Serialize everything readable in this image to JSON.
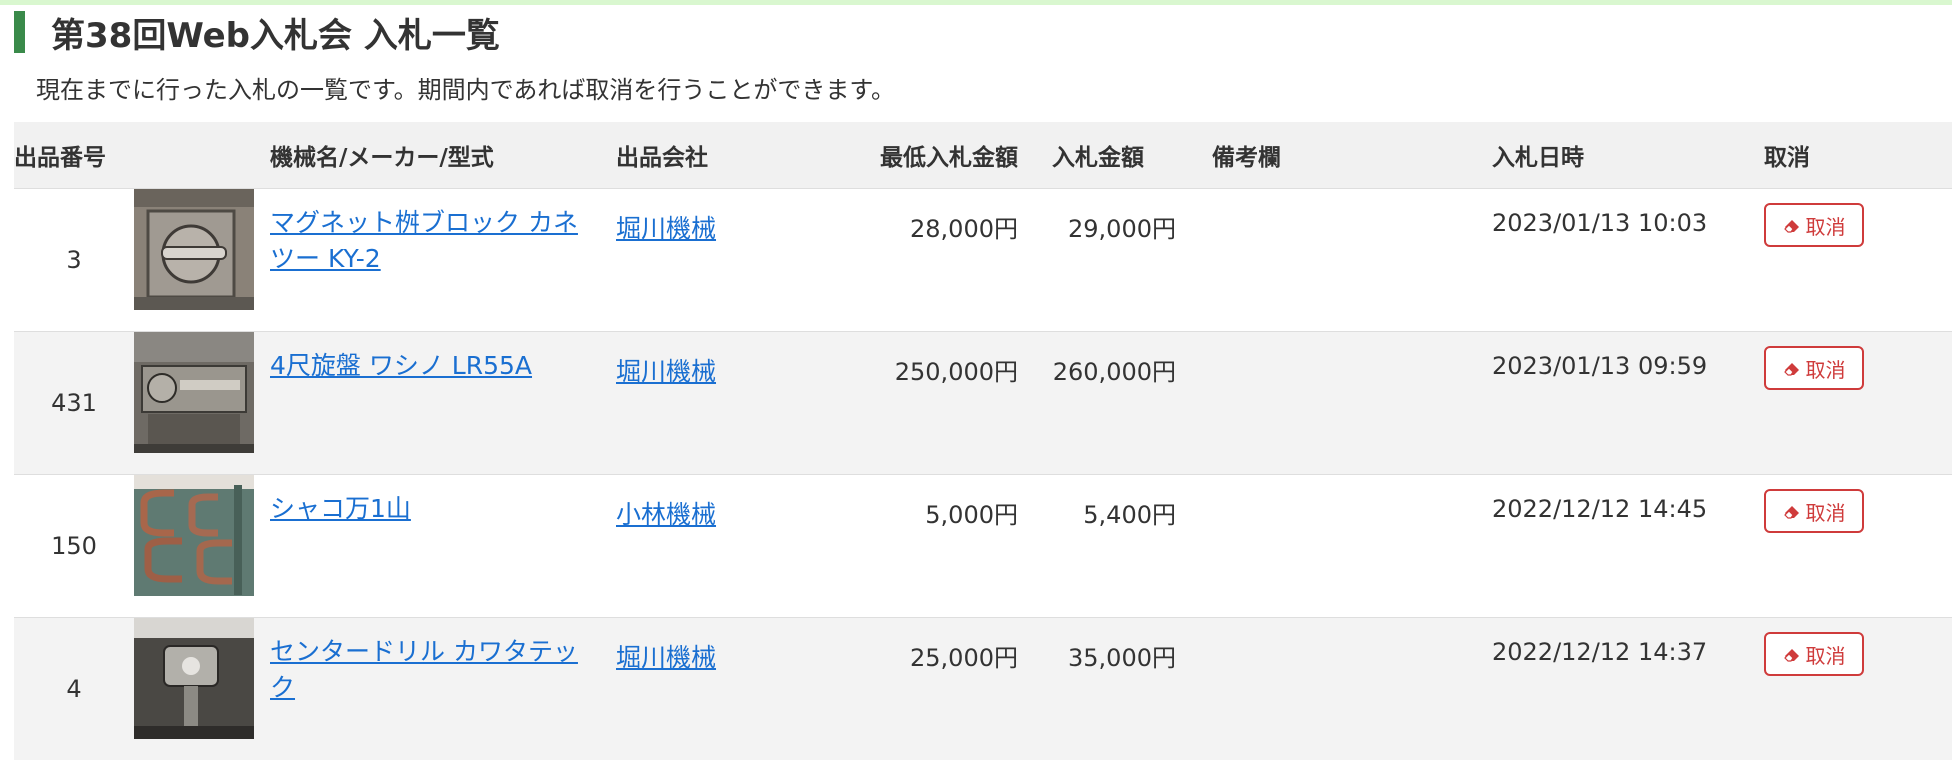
{
  "page": {
    "title": "第38回Web入札会 入札一覧",
    "description": "現在までに行った入札の一覧です。期間内であれば取消を行うことができます。",
    "accent_color": "#3a8a4a",
    "link_color": "#1a6fd1",
    "cancel_color": "#cf3b3b"
  },
  "table": {
    "headers": {
      "no": "出品番号",
      "name": "機械名/メーカー/型式",
      "company": "出品会社",
      "min_price": "最低入札金額",
      "bid_price": "入札金額",
      "note": "備考欄",
      "date": "入札日時",
      "cancel": "取消"
    },
    "rows": [
      {
        "no": "3",
        "name": "マグネット桝ブロック カネツー KY-2",
        "company": "堀川機械",
        "min_price": "28,000円",
        "bid_price": "29,000円",
        "note": "",
        "date": "2023/01/13 10:03",
        "cancel_label": "取消",
        "thumb_icon": "magnet-block-photo"
      },
      {
        "no": "431",
        "name": "4尺旋盤 ワシノ LR55A",
        "company": "堀川機械",
        "min_price": "250,000円",
        "bid_price": "260,000円",
        "note": "",
        "date": "2023/01/13 09:59",
        "cancel_label": "取消",
        "thumb_icon": "lathe-photo"
      },
      {
        "no": "150",
        "name": "シャコ万1山",
        "company": "小林機械",
        "min_price": "5,000円",
        "bid_price": "5,400円",
        "note": "",
        "date": "2022/12/12 14:45",
        "cancel_label": "取消",
        "thumb_icon": "c-clamp-photo"
      },
      {
        "no": "4",
        "name": "センタードリル カワタテック",
        "company": "堀川機械",
        "min_price": "25,000円",
        "bid_price": "35,000円",
        "note": "",
        "date": "2022/12/12 14:37",
        "cancel_label": "取消",
        "thumb_icon": "center-drill-photo"
      }
    ]
  }
}
